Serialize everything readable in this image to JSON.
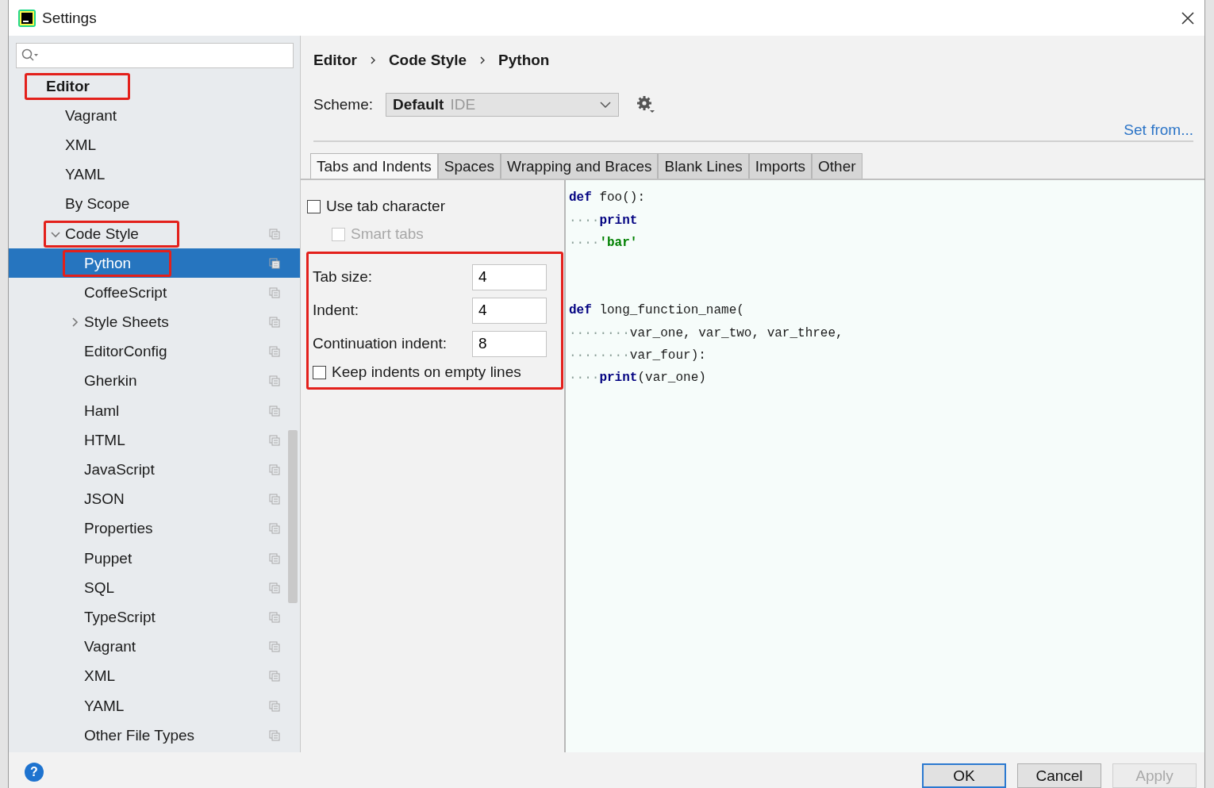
{
  "window": {
    "title": "Settings"
  },
  "sidebar": {
    "tree": [
      {
        "label": "Editor",
        "bold": true,
        "highlighted": true,
        "selected": false,
        "children": [
          {
            "label": "Vagrant",
            "selected": false,
            "highlighted": false,
            "project_scope": false
          },
          {
            "label": "XML",
            "selected": false,
            "highlighted": false,
            "project_scope": false
          },
          {
            "label": "YAML",
            "selected": false,
            "highlighted": false,
            "project_scope": false
          },
          {
            "label": "By Scope",
            "selected": false,
            "highlighted": false,
            "project_scope": false
          },
          {
            "label": "Code Style",
            "selected": false,
            "highlighted": true,
            "project_scope": true,
            "expanded": true,
            "children": [
              {
                "label": "Python",
                "selected": true,
                "highlighted": true,
                "project_scope": true
              },
              {
                "label": "CoffeeScript",
                "selected": false,
                "highlighted": false,
                "project_scope": true
              },
              {
                "label": "Style Sheets",
                "selected": false,
                "highlighted": false,
                "project_scope": true,
                "expanded": false
              },
              {
                "label": "EditorConfig",
                "selected": false,
                "highlighted": false,
                "project_scope": true
              },
              {
                "label": "Gherkin",
                "selected": false,
                "highlighted": false,
                "project_scope": true
              },
              {
                "label": "Haml",
                "selected": false,
                "highlighted": false,
                "project_scope": true
              },
              {
                "label": "HTML",
                "selected": false,
                "highlighted": false,
                "project_scope": true
              },
              {
                "label": "JavaScript",
                "selected": false,
                "highlighted": false,
                "project_scope": true
              },
              {
                "label": "JSON",
                "selected": false,
                "highlighted": false,
                "project_scope": true
              },
              {
                "label": "Properties",
                "selected": false,
                "highlighted": false,
                "project_scope": true
              },
              {
                "label": "Puppet",
                "selected": false,
                "highlighted": false,
                "project_scope": true
              },
              {
                "label": "SQL",
                "selected": false,
                "highlighted": false,
                "project_scope": true
              },
              {
                "label": "TypeScript",
                "selected": false,
                "highlighted": false,
                "project_scope": true
              },
              {
                "label": "Vagrant",
                "selected": false,
                "highlighted": false,
                "project_scope": true
              },
              {
                "label": "XML",
                "selected": false,
                "highlighted": false,
                "project_scope": true
              },
              {
                "label": "YAML",
                "selected": false,
                "highlighted": false,
                "project_scope": true
              },
              {
                "label": "Other File Types",
                "selected": false,
                "highlighted": false,
                "project_scope": true
              }
            ]
          }
        ]
      }
    ]
  },
  "breadcrumb": [
    "Editor",
    "Code Style",
    "Python"
  ],
  "scheme": {
    "label": "Scheme:",
    "name": "Default",
    "qualifier": "IDE"
  },
  "set_from_link": "Set from...",
  "tabs": [
    {
      "label": "Tabs and Indents",
      "selected": true
    },
    {
      "label": "Spaces",
      "selected": false
    },
    {
      "label": "Wrapping and Braces",
      "selected": false
    },
    {
      "label": "Blank Lines",
      "selected": false
    },
    {
      "label": "Imports",
      "selected": false
    },
    {
      "label": "Other",
      "selected": false
    }
  ],
  "options": {
    "top": [
      {
        "kind": "checkbox",
        "label": "Use tab character",
        "checked": false,
        "disabled": false,
        "children": [
          {
            "kind": "checkbox",
            "label": "Smart tabs",
            "checked": false,
            "disabled": true
          }
        ]
      }
    ],
    "group": {
      "highlighted": true,
      "items": [
        {
          "kind": "number",
          "label": "Tab size:",
          "value": "4"
        },
        {
          "kind": "number",
          "label": "Indent:",
          "value": "4"
        },
        {
          "kind": "number",
          "label": "Continuation indent:",
          "value": "8"
        },
        {
          "kind": "checkbox",
          "label": "Keep indents on empty lines",
          "checked": false,
          "disabled": false
        }
      ]
    }
  },
  "preview": {
    "lines": [
      {
        "kind": "code",
        "tokens": [
          {
            "kind": "keyword",
            "text": "def"
          },
          {
            "kind": "plain",
            "text": " foo():"
          }
        ]
      },
      {
        "kind": "code",
        "tokens": [
          {
            "kind": "whitespace",
            "text": "····"
          },
          {
            "kind": "keyword",
            "text": "print"
          }
        ]
      },
      {
        "kind": "code",
        "tokens": [
          {
            "kind": "whitespace",
            "text": "····"
          },
          {
            "kind": "string",
            "text": "'bar'"
          }
        ]
      },
      {
        "kind": "blank"
      },
      {
        "kind": "blank"
      },
      {
        "kind": "code",
        "tokens": [
          {
            "kind": "keyword",
            "text": "def"
          },
          {
            "kind": "plain",
            "text": " long_function_name("
          }
        ]
      },
      {
        "kind": "code",
        "tokens": [
          {
            "kind": "whitespace",
            "text": "········"
          },
          {
            "kind": "plain",
            "text": "var_one, var_two, var_three,"
          }
        ]
      },
      {
        "kind": "code",
        "tokens": [
          {
            "kind": "whitespace",
            "text": "········"
          },
          {
            "kind": "plain",
            "text": "var_four):"
          }
        ]
      },
      {
        "kind": "code",
        "tokens": [
          {
            "kind": "whitespace",
            "text": "····"
          },
          {
            "kind": "keyword",
            "text": "print"
          },
          {
            "kind": "plain",
            "text": "(var_one)"
          }
        ]
      }
    ]
  },
  "help_button": "?",
  "buttons": [
    {
      "label": "OK",
      "kind": "default",
      "disabled": false
    },
    {
      "label": "Cancel",
      "kind": "normal",
      "disabled": false
    },
    {
      "label": "Apply",
      "kind": "normal",
      "disabled": true
    }
  ]
}
